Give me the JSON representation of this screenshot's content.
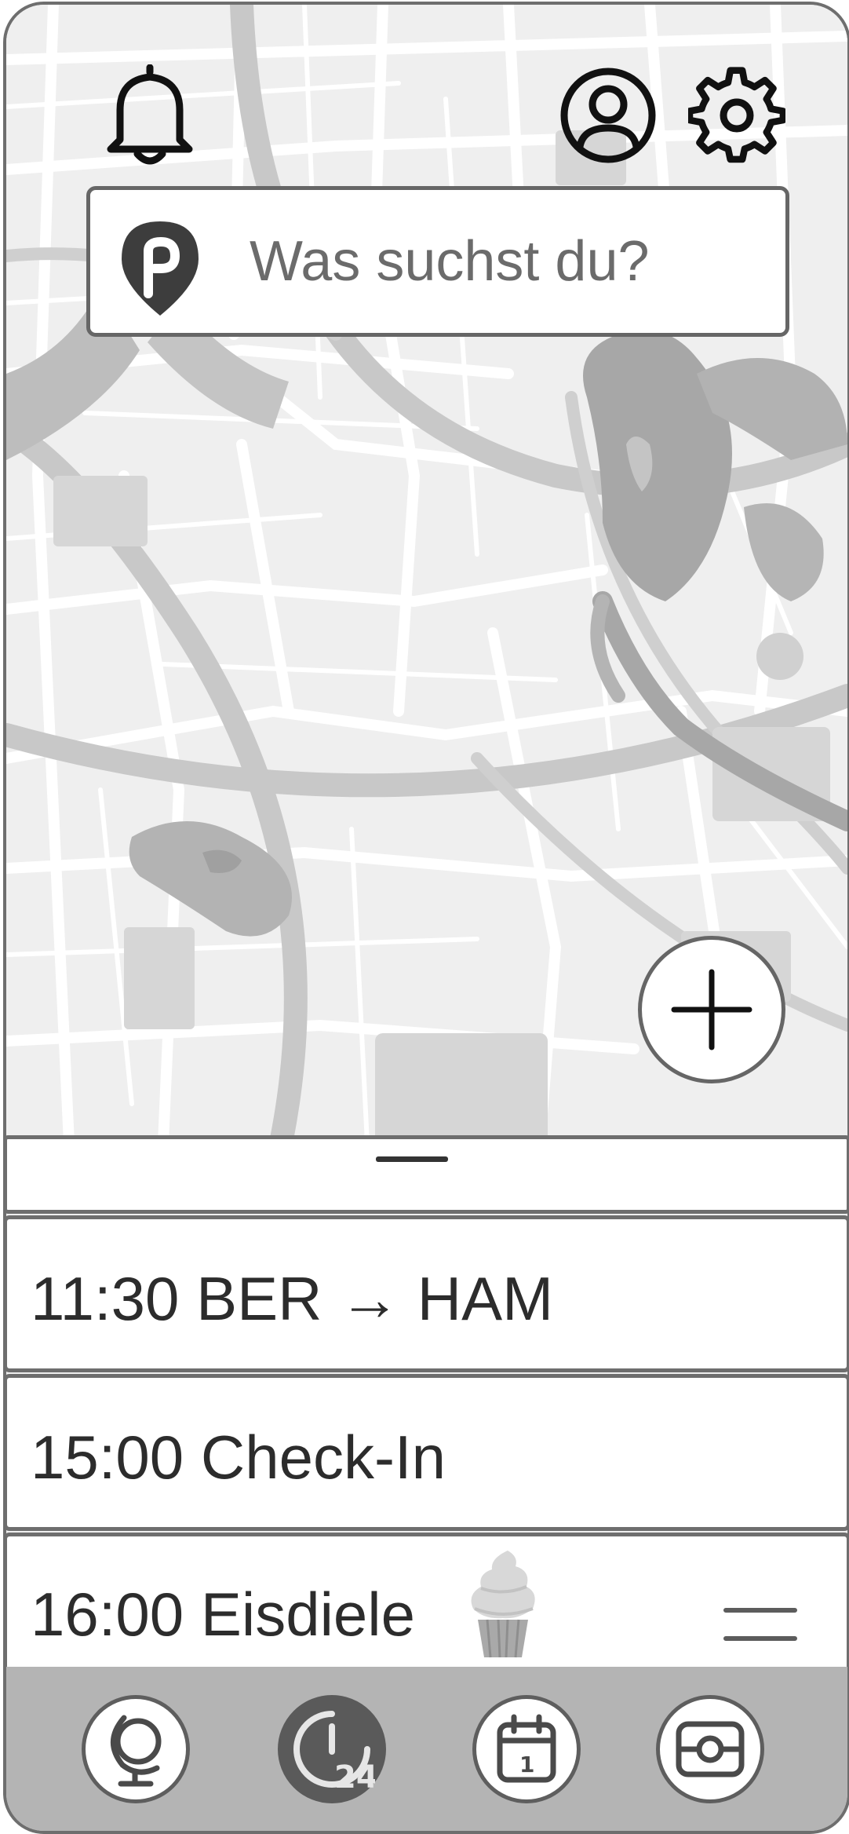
{
  "search": {
    "placeholder": "Was suchst du?"
  },
  "header": {
    "icons": [
      "bell-icon",
      "user-circle-icon",
      "gear-icon"
    ]
  },
  "map": {
    "add_button_icon": "plus-icon"
  },
  "schedule": {
    "items": [
      {
        "label": "11:30 BER → HAM"
      },
      {
        "label": "15:00 Check-In"
      },
      {
        "label": "16:00 Eisdiele",
        "icon": "ice-cream-icon",
        "action_icon": "drag-handle-icon"
      }
    ]
  },
  "tabbar": {
    "tabs": [
      {
        "icon": "globe-icon",
        "active": false
      },
      {
        "icon": "clock-24-icon",
        "active": true
      },
      {
        "icon": "calendar-icon",
        "calendar_day": "1",
        "active": false
      },
      {
        "icon": "ticket-icon",
        "active": false
      }
    ],
    "clock_label": "24"
  },
  "colors": {
    "map_background": "#efefef",
    "map_roads": "#ffffff",
    "map_major_roads": "#c8c8c8",
    "map_water": "#a7a7a7",
    "map_blocks": "#d6d6d6",
    "tabbar_background": "#b4b4b4",
    "active_tab": "#5a5a5a",
    "border": "#6e6e6e",
    "text": "#2c2c2c",
    "placeholder": "#6b6b6b"
  }
}
